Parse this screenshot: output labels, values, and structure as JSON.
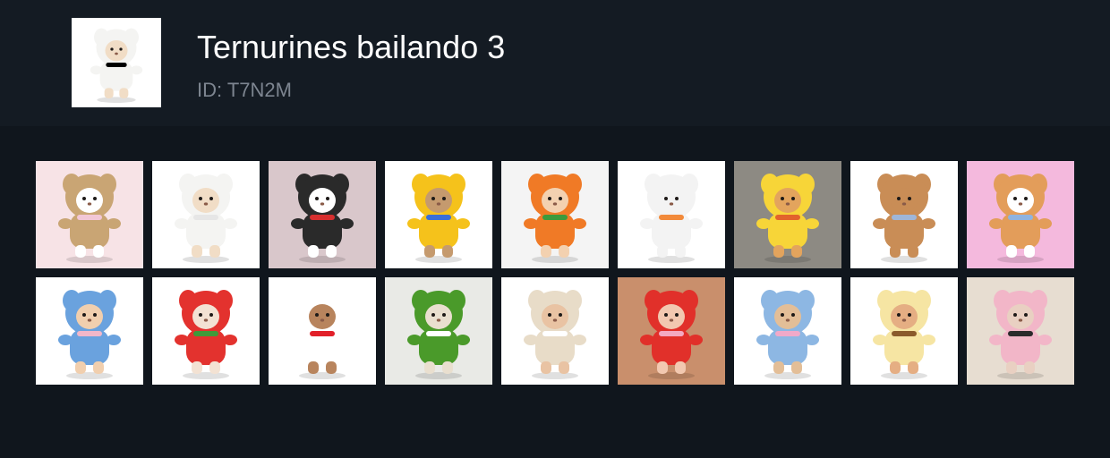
{
  "pack": {
    "title": "Ternurines bailando 3",
    "id_text": "ID: T7N2M",
    "cover": {
      "label": "ghost-costume",
      "bg": "#ffffff",
      "costume": "#f4f4f2",
      "face": "#f1ddc6"
    }
  },
  "stickers": [
    {
      "label": "bunny-pink-bow",
      "bg": "#f7e3e6",
      "costume": "#c9a574",
      "face": "#ffffff",
      "accent": "#f2c7d6"
    },
    {
      "label": "ghost-costume",
      "bg": "#ffffff",
      "costume": "#f4f4f2",
      "face": "#f1ddc6",
      "accent": "#e6e6e6"
    },
    {
      "label": "cat-strawberry-dress",
      "bg": "#d9c7cb",
      "costume": "#2a2a2a",
      "face": "#ffffff",
      "accent": "#d72f2f"
    },
    {
      "label": "yellow-bear-hood",
      "bg": "#ffffff",
      "costume": "#f5c21b",
      "face": "#c59a6e",
      "accent": "#3a6fd8"
    },
    {
      "label": "orange-leaf-hat",
      "bg": "#f4f4f4",
      "costume": "#f07a26",
      "face": "#f3d1b0",
      "accent": "#3c9a3c"
    },
    {
      "label": "mouse-orange-overalls",
      "bg": "#ffffff",
      "costume": "#f3f3f3",
      "face": "#f3f3f3",
      "accent": "#f28a3a"
    },
    {
      "label": "cat-yellow-raincoat",
      "bg": "#8d8a83",
      "costume": "#f7d538",
      "face": "#e3a45d",
      "accent": "#e2632c"
    },
    {
      "label": "puppy-blue-bucket",
      "bg": "#ffffff",
      "costume": "#c98d56",
      "face": "#c98d56",
      "accent": "#9fb6d8"
    },
    {
      "label": "cat-blue-beret",
      "bg": "#f4b9dd",
      "costume": "#e39d5a",
      "face": "#ffffff",
      "accent": "#8fb3e0"
    },
    {
      "label": "baby-blue-apron",
      "bg": "#ffffff",
      "costume": "#6aa2de",
      "face": "#f1cfae",
      "accent": "#f3b7c9"
    },
    {
      "label": "rabbit-strawberry-skirt",
      "bg": "#ffffff",
      "costume": "#e3322e",
      "face": "#f3e2d3",
      "accent": "#3f9a3a"
    },
    {
      "label": "hello-kitty-hood",
      "bg": "#ffffff",
      "costume": "#ffffff",
      "face": "#b8845d",
      "accent": "#e2202a"
    },
    {
      "label": "sheep-green-overalls",
      "bg": "#e9eae6",
      "costume": "#4a9a2a",
      "face": "#e9dfcf",
      "accent": "#ffffff"
    },
    {
      "label": "kitten-cream-romper",
      "bg": "#ffffff",
      "costume": "#e8dcc8",
      "face": "#e9c3a3",
      "accent": "#ffffff"
    },
    {
      "label": "strawberry-hood",
      "bg": "#c98f6c",
      "costume": "#e1302a",
      "face": "#f2c8b0",
      "accent": "#f4a9c1"
    },
    {
      "label": "bear-blue-overalls",
      "bg": "#ffffff",
      "costume": "#8db7e3",
      "face": "#e3be97",
      "accent": "#f0a9c9"
    },
    {
      "label": "pompompurin-costume",
      "bg": "#ffffff",
      "costume": "#f6e5a3",
      "face": "#e5ae83",
      "accent": "#8a5a2b"
    },
    {
      "label": "rabbit-pink-tutu",
      "bg": "#e7ddd1",
      "costume": "#f2b6c8",
      "face": "#e9d0c2",
      "accent": "#2b2b2b"
    }
  ]
}
